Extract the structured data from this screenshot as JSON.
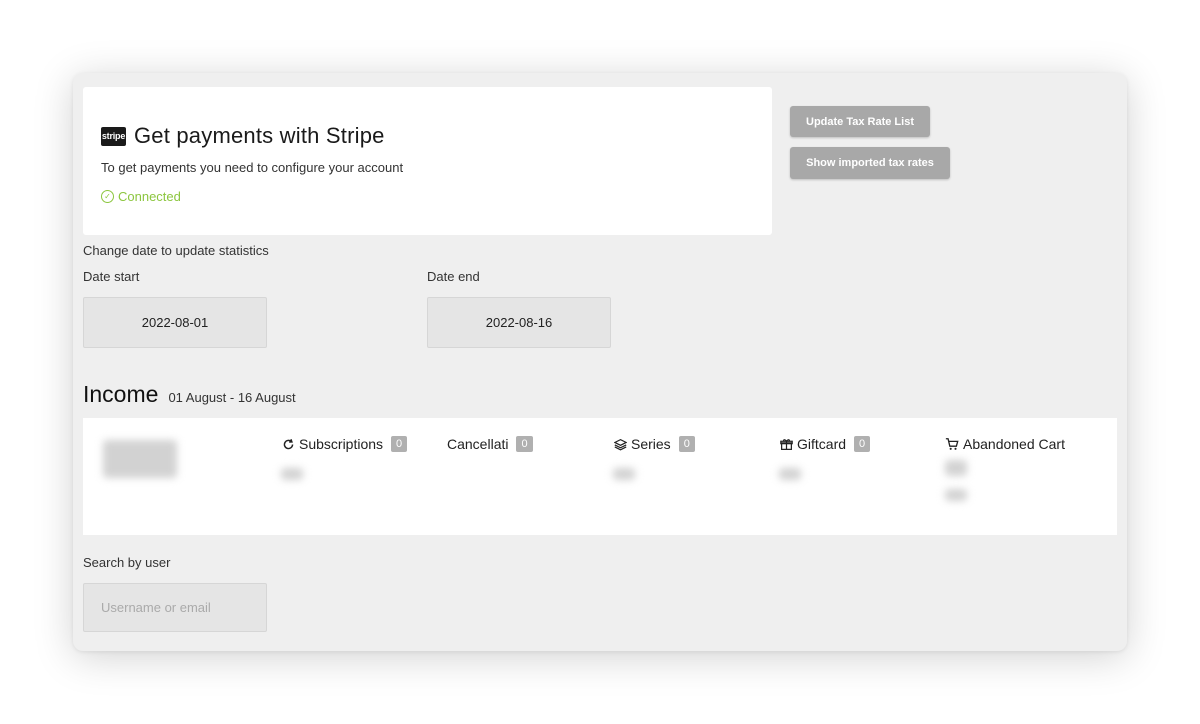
{
  "stripe": {
    "logo_text": "stripe",
    "title": "Get payments with Stripe",
    "description": "To get payments you need to configure your account",
    "status": "Connected",
    "status_color": "#8cc63f"
  },
  "tax": {
    "update_label": "Update Tax Rate List",
    "imported_label": "Show imported tax rates"
  },
  "dates": {
    "intro": "Change date to update statistics",
    "start_label": "Date start",
    "start_value": "2022-08-01",
    "end_label": "Date end",
    "end_value": "2022-08-16"
  },
  "income": {
    "title": "Income",
    "range": "01 August - 16 August",
    "stats": [
      {
        "label": "Subscriptions",
        "count": "0",
        "icon": "refresh-icon"
      },
      {
        "label": "Cancellati",
        "count": "0",
        "icon": ""
      },
      {
        "label": "Series",
        "count": "0",
        "icon": "layers-icon"
      },
      {
        "label": "Giftcard",
        "count": "0",
        "icon": "gift-icon"
      },
      {
        "label": "Abandoned Cart",
        "icon": "cart-icon"
      }
    ]
  },
  "search": {
    "label": "Search by user",
    "placeholder": "Username or email"
  }
}
